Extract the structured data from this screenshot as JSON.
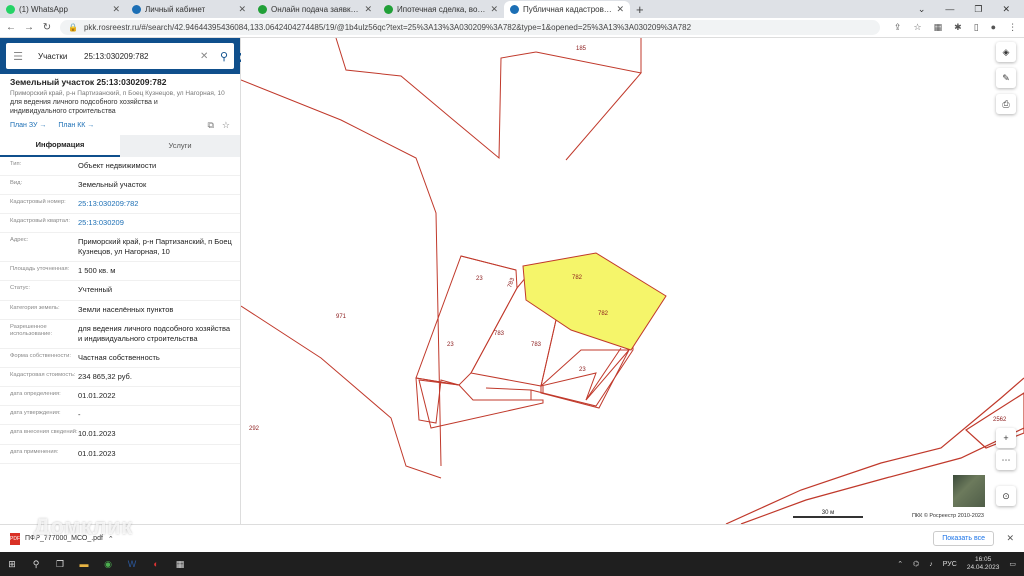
{
  "browser": {
    "tabs": [
      {
        "title": "(1) WhatsApp",
        "color": "#25d366",
        "active": false
      },
      {
        "title": "Личный кабинет",
        "color": "#1c6fb5",
        "active": false
      },
      {
        "title": "Онлайн подача заявки на ипотеку",
        "color": "#21a038",
        "active": false
      },
      {
        "title": "Ипотечная сделка, войти в личный",
        "color": "#21a038",
        "active": false
      },
      {
        "title": "Публичная кадастровая карта",
        "color": "#1c6fb5",
        "active": true
      }
    ],
    "new_tab": "+",
    "window_controls": [
      "⌄",
      "—",
      "❐",
      "✕"
    ],
    "url": "pkk.rosreestr.ru/#/search/42.94644395436084,133.0642404274485/19/@1b4ulz56qc?text=25%3A13%3A030209%3A782&type=1&opened=25%3A13%3A030209%3A782"
  },
  "search": {
    "type_label": "Участки",
    "query": "25:13:030209:782"
  },
  "object": {
    "title": "Земельный участок 25:13:030209:782",
    "address": "Приморский край, р-н Партизанский, п Боец Кузнецов, ул Нагорная, 10",
    "purpose": "для ведения личного подсобного хозяйства и индивидуального строительства",
    "link_plan_zu": "План ЗУ →",
    "link_plan_kk": "План КК →"
  },
  "info_tabs": {
    "info": "Информация",
    "services": "Услуги"
  },
  "attributes": [
    {
      "key": "Тип:",
      "value": "Объект недвижимости",
      "link": false
    },
    {
      "key": "Вид:",
      "value": "Земельный участок",
      "link": false
    },
    {
      "key": "Кадастровый номер:",
      "value": "25:13:030209:782",
      "link": true
    },
    {
      "key": "Кадастровый квартал:",
      "value": "25:13:030209",
      "link": true
    },
    {
      "key": "Адрес:",
      "value": "Приморский край, р-н Партизанский, п Боец Кузнецов, ул Нагорная, 10",
      "link": false
    },
    {
      "key": "Площадь уточненная:",
      "value": "1 500 кв. м",
      "link": false
    },
    {
      "key": "Статус:",
      "value": "Учтенный",
      "link": false
    },
    {
      "key": "Категория земель:",
      "value": "Земли населённых пунктов",
      "link": false
    },
    {
      "key": "Разрешенное использование:",
      "value": "для ведения личного подсобного хозяйства и индивидуального строительства",
      "link": false
    },
    {
      "key": "Форма собственности:",
      "value": "Частная собственность",
      "link": false
    },
    {
      "key": "Кадастровая стоимость:",
      "value": "234 865,32 руб.",
      "link": false
    },
    {
      "key": "дата определения:",
      "value": "01.01.2022",
      "link": false
    },
    {
      "key": "дата утверждения:",
      "value": "-",
      "link": false
    },
    {
      "key": "дата внесения сведений:",
      "value": "10.01.2023",
      "link": false
    },
    {
      "key": "дата применения:",
      "value": "01.01.2023",
      "link": false
    }
  ],
  "map": {
    "parcel_labels": {
      "p185": "185",
      "p971": "971",
      "p292": "292",
      "p23a": "23",
      "p23b": "23",
      "p23c": "23",
      "p783a": "783",
      "p783b": "783",
      "p783c": "783",
      "p782a": "782",
      "p782b": "782",
      "p2562": "2562"
    },
    "highlight_color": "#f5f56a",
    "boundary_color": "#c0392b",
    "scale": "30 м",
    "copyright": "ПКК © Росреестр 2010-2023"
  },
  "downloads": {
    "file": "ПФР_777000_МСО_.pdf",
    "show_all": "Показать все"
  },
  "watermark": "Домклик",
  "taskbar": {
    "lang": "РУС",
    "time": "16:05",
    "date": "24.04.2023"
  }
}
